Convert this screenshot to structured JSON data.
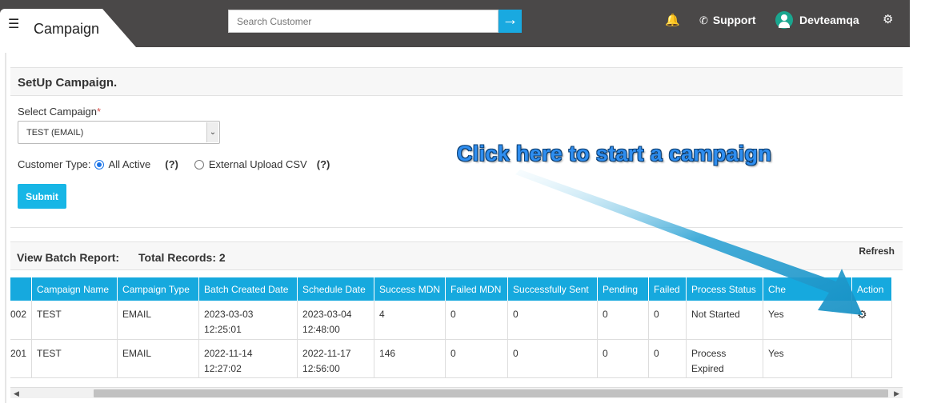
{
  "header": {
    "title": "Campaign",
    "search_placeholder": "Search Customer",
    "support_label": "Support",
    "username": "Devteamqa"
  },
  "setup": {
    "heading": "SetUp Campaign.",
    "select_label": "Select Campaign",
    "required_mark": "*",
    "selected_campaign": "TEST (EMAIL)",
    "customer_type_label": "Customer Type:",
    "option_all_active": "All Active",
    "option_external_csv": "External Upload CSV",
    "help_label": "(?)",
    "selected_customer_type": "All Active",
    "submit_label": "Submit"
  },
  "batch": {
    "heading": "View Batch Report:",
    "total_records": "Total Records: 2",
    "refresh_label": "Refresh",
    "columns": [
      "Campaign Name",
      "Campaign Type",
      "Batch Created Date",
      "Schedule Date",
      "Success MDN",
      "Failed MDN",
      "Successfully Sent",
      "Pending",
      "Failed",
      "Process Status",
      "Che",
      "Action"
    ],
    "rows": [
      {
        "id": "002",
        "name": "TEST",
        "type": "EMAIL",
        "created": "2023-03-03 12:25:01",
        "schedule": "2023-03-04 12:48:00",
        "success_mdn": "4",
        "failed_mdn": "0",
        "sent": "0",
        "pending": "0",
        "failed": "0",
        "status": "Not Started",
        "che": "Yes"
      },
      {
        "id": "201",
        "name": "TEST",
        "type": "EMAIL",
        "created": "2022-11-14 12:27:02",
        "schedule": "2022-11-17 12:56:00",
        "success_mdn": "146",
        "failed_mdn": "0",
        "sent": "0",
        "pending": "0",
        "failed": "0",
        "status": "Process Expired",
        "che": "Yes"
      }
    ]
  },
  "annotation": {
    "text": "Click here to start a campaign"
  },
  "colors": {
    "topbar": "#4a4848",
    "accent": "#16a9de",
    "submit": "#17b6e6",
    "required": "#d9534f"
  },
  "icons": [
    "menu-icon",
    "arrow-right-icon",
    "bell-icon",
    "phone-icon",
    "user-avatar-icon",
    "gear-icon",
    "settings-action-icon"
  ]
}
